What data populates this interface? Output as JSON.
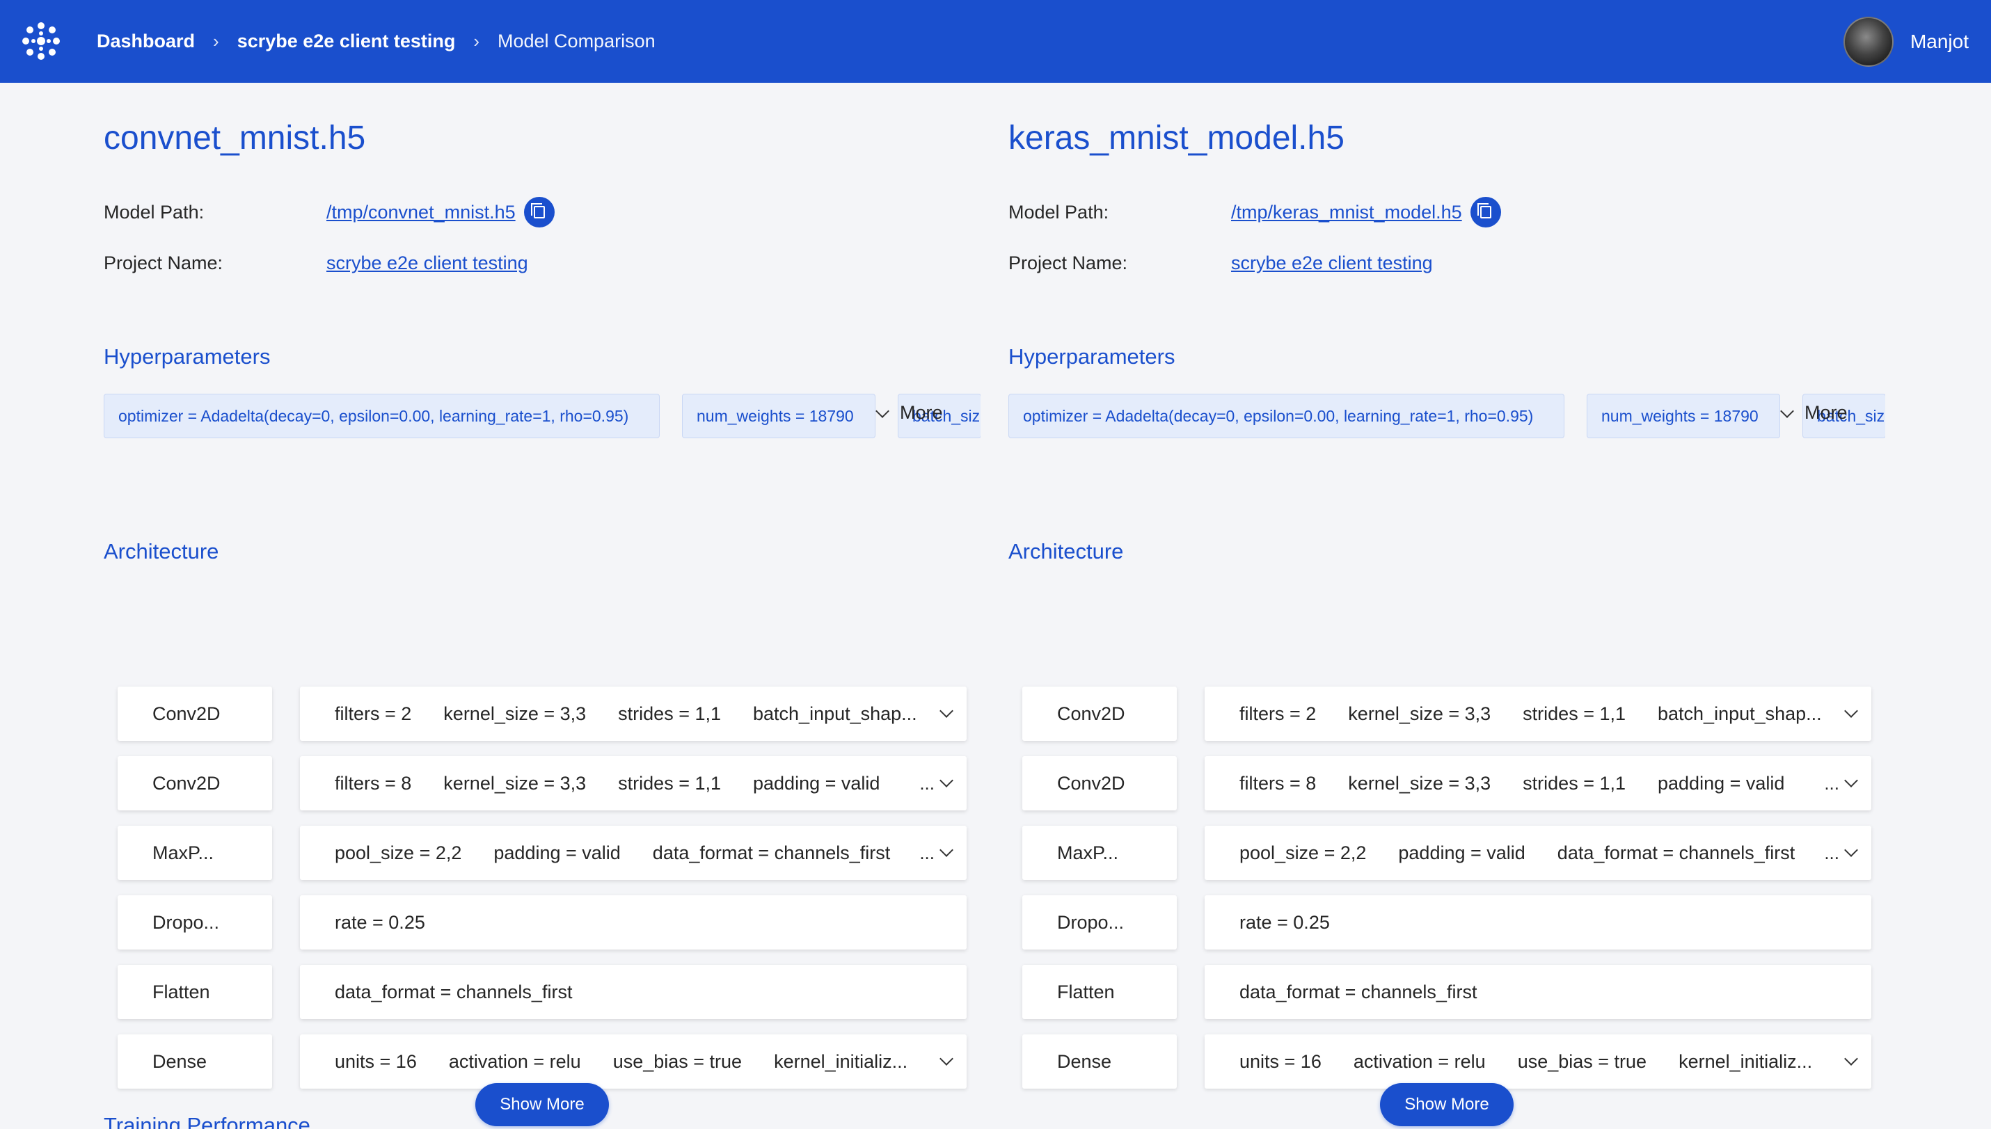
{
  "header": {
    "logo_icon": "scrybe-logo-icon",
    "breadcrumb": [
      "Dashboard",
      "scrybe e2e client testing",
      "Model Comparison"
    ],
    "user_name": "Manjot"
  },
  "labels": {
    "model_path": "Model Path:",
    "project_name": "Project Name:",
    "hyperparameters": "Hyperparameters",
    "architecture": "Architecture",
    "more": "More",
    "show_more": "Show More",
    "ellipsis": "...",
    "training_performance": "Training Performance"
  },
  "models": [
    {
      "title": "convnet_mnist.h5",
      "model_path": "/tmp/convnet_mnist.h5",
      "project_name": "scrybe e2e client testing",
      "hyperparameters": [
        "optimizer = Adadelta(decay=0, epsilon=0.00, learning_rate=1, rho=0.95)",
        "num_weights = 18790",
        "batch_siz"
      ],
      "architecture": [
        {
          "layer": "Conv2D",
          "params": [
            "filters = 2",
            "kernel_size = 3,3",
            "strides = 1,1",
            "batch_input_shap..."
          ],
          "expand": "chevron"
        },
        {
          "layer": "Conv2D",
          "params": [
            "filters = 8",
            "kernel_size = 3,3",
            "strides = 1,1",
            "padding = valid"
          ],
          "expand": "ellipsis"
        },
        {
          "layer": "MaxP...",
          "params": [
            "pool_size = 2,2",
            "padding = valid",
            "data_format = channels_first"
          ],
          "expand": "ellipsis"
        },
        {
          "layer": "Dropo...",
          "params": [
            "rate = 0.25"
          ],
          "expand": "none"
        },
        {
          "layer": "Flatten",
          "params": [
            "data_format = channels_first"
          ],
          "expand": "none"
        },
        {
          "layer": "Dense",
          "params": [
            "units = 16",
            "activation = relu",
            "use_bias = true",
            "kernel_initializ..."
          ],
          "expand": "chevron"
        }
      ]
    },
    {
      "title": "keras_mnist_model.h5",
      "model_path": "/tmp/keras_mnist_model.h5",
      "project_name": "scrybe e2e client testing",
      "hyperparameters": [
        "optimizer = Adadelta(decay=0, epsilon=0.00, learning_rate=1, rho=0.95)",
        "num_weights = 18790",
        "batch_siz"
      ],
      "architecture": [
        {
          "layer": "Conv2D",
          "params": [
            "filters = 2",
            "kernel_size = 3,3",
            "strides = 1,1",
            "batch_input_shap..."
          ],
          "expand": "chevron"
        },
        {
          "layer": "Conv2D",
          "params": [
            "filters = 8",
            "kernel_size = 3,3",
            "strides = 1,1",
            "padding = valid"
          ],
          "expand": "ellipsis"
        },
        {
          "layer": "MaxP...",
          "params": [
            "pool_size = 2,2",
            "padding = valid",
            "data_format = channels_first"
          ],
          "expand": "ellipsis"
        },
        {
          "layer": "Dropo...",
          "params": [
            "rate = 0.25"
          ],
          "expand": "none"
        },
        {
          "layer": "Flatten",
          "params": [
            "data_format = channels_first"
          ],
          "expand": "none"
        },
        {
          "layer": "Dense",
          "params": [
            "units = 16",
            "activation = relu",
            "use_bias = true",
            "kernel_initializ..."
          ],
          "expand": "chevron"
        }
      ]
    }
  ],
  "colors": {
    "brand": "#1a4fcd",
    "background": "#f4f5f8",
    "chip_bg": "#e4ecfb"
  }
}
